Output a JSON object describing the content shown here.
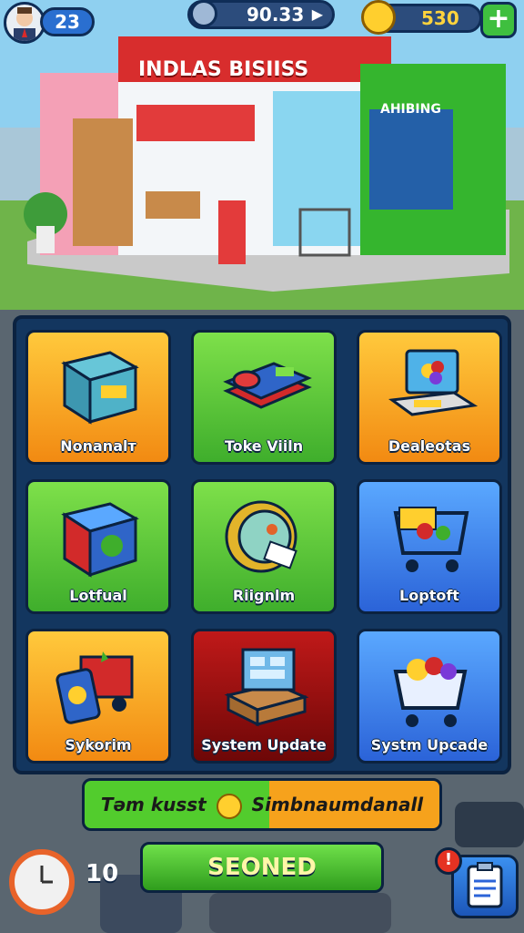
{
  "hud": {
    "level": "23",
    "cash": "90.33",
    "coins": "530",
    "plus_label": "+"
  },
  "store": {
    "sign": "INDLAS BISIISS",
    "side_sign": "AHIBING"
  },
  "menu": {
    "tiles": [
      {
        "label": "Nonanalт",
        "color": "orange",
        "icon": "product-box-icon"
      },
      {
        "label": "Toke Viiln",
        "color": "green",
        "icon": "stacked-cards-icon"
      },
      {
        "label": "Dealeotas",
        "color": "orange",
        "icon": "computer-register-icon"
      },
      {
        "label": "Lotfual",
        "color": "green",
        "icon": "globe-box-icon"
      },
      {
        "label": "Riignlm",
        "color": "green",
        "icon": "coin-receipt-icon"
      },
      {
        "label": "Loptoft",
        "color": "blue",
        "icon": "shopping-cart-icon"
      },
      {
        "label": "Sykorim",
        "color": "orange",
        "icon": "delivery-truck-icon"
      },
      {
        "label": "System Update",
        "color": "red",
        "icon": "cash-drawer-icon"
      },
      {
        "label": "Systm Upcade",
        "color": "blue",
        "icon": "full-cart-icon"
      }
    ]
  },
  "promo": {
    "text_left": "Təm kusst",
    "text_right": "Simbnaumdanall"
  },
  "footer": {
    "main_button": "SEONED",
    "timer_value": "10",
    "alert_badge": "!"
  },
  "colors": {
    "panel": "#13365f",
    "orange": "#f28a12",
    "green": "#3fae2c",
    "blue": "#2b63d8",
    "red": "#a31212"
  }
}
